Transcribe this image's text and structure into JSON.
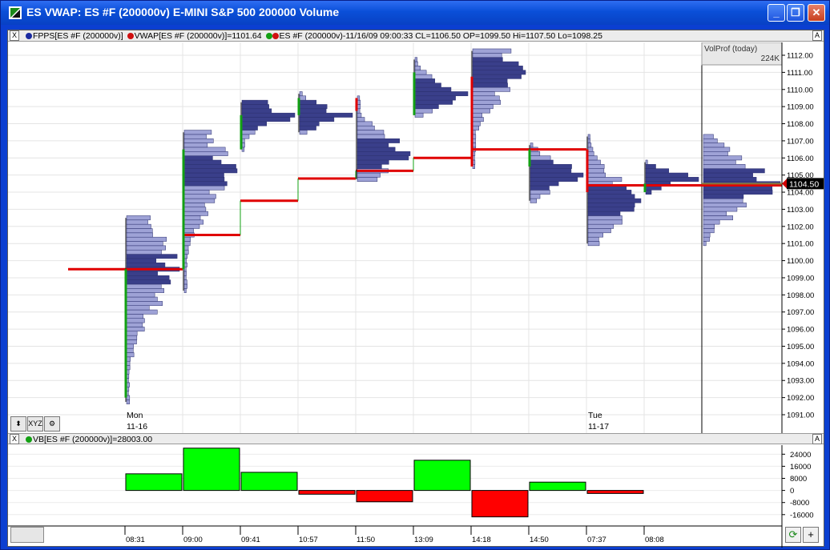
{
  "window": {
    "title": "ES VWAP: ES #F (200000v) E-MINI S&P 500 200000 Volume",
    "buttons": {
      "minimize": "_",
      "maximize": "❐",
      "close": "✕"
    }
  },
  "main_panel": {
    "close_label": "X",
    "auto_label": "A",
    "legend": [
      {
        "color": "#1a2aa0",
        "text": "FPPS[ES #F (200000v)]"
      },
      {
        "color": "#d01010",
        "text": "VWAP[ES #F (200000v)]=1101.64"
      },
      {
        "color": "#13a013",
        "color2": "#d01010",
        "text": "ES #F (200000v)-11/16/09 09:00:33 CL=1106.50 OP=1099.50 Hi=1107.50 Lo=1098.25"
      }
    ],
    "volprof": {
      "label": "VolProf (today)",
      "volume": "224K"
    },
    "price_label": "1104.50",
    "day_labels": [
      {
        "line1": "Mon",
        "line2": "11-16"
      },
      {
        "line1": "Tue",
        "line2": "11-17"
      }
    ],
    "tools": [
      "⬍",
      "XYZ",
      "⚙"
    ]
  },
  "vb_panel": {
    "close_label": "X",
    "auto_label": "A",
    "legend": {
      "color": "#13a013",
      "text": "VB[ES #F (200000v)]=28003.00"
    }
  },
  "footer_buttons": [
    "⟳",
    "+"
  ],
  "chart_data": [
    {
      "type": "bar",
      "subtype": "volume-profile-candles",
      "title": "",
      "y_axis": {
        "range": [
          1091,
          1112
        ],
        "ticks": [
          "1091.00",
          "1092.00",
          "1093.00",
          "1094.00",
          "1095.00",
          "1096.00",
          "1097.00",
          "1098.00",
          "1099.00",
          "1100.00",
          "1101.00",
          "1102.00",
          "1103.00",
          "1104.00",
          "1105.00",
          "1106.00",
          "1107.00",
          "1108.00",
          "1109.00",
          "1110.00",
          "1111.00",
          "1112.00"
        ]
      },
      "grid": true,
      "bars": [
        {
          "time": "08:31",
          "open": 1092.0,
          "close": 1099.5,
          "low": 1091.75,
          "high": 1102.5,
          "vwap": 1099.5,
          "poc": 1099.5,
          "color": "green"
        },
        {
          "time": "09:00",
          "open": 1099.5,
          "close": 1106.5,
          "low": 1098.25,
          "high": 1107.5,
          "vwap": 1101.5,
          "poc": 1105.25,
          "color": "green"
        },
        {
          "time": "09:41",
          "open": 1106.5,
          "close": 1108.5,
          "low": 1106.5,
          "high": 1109.25,
          "vwap": 1103.5,
          "poc": 1108.5,
          "color": "green"
        },
        {
          "time": "10:57",
          "open": 1108.5,
          "close": 1109.5,
          "low": 1107.5,
          "high": 1109.75,
          "vwap": 1104.8,
          "poc": 1108.5,
          "color": "green"
        },
        {
          "time": "11:50",
          "open": 1109.5,
          "close": 1108.75,
          "low": 1104.75,
          "high": 1109.5,
          "vwap": 1105.25,
          "poc": 1106.25,
          "color": "red"
        },
        {
          "time": "13:09",
          "open": 1108.5,
          "close": 1111.0,
          "low": 1108.5,
          "high": 1111.75,
          "vwap": 1106.0,
          "poc": 1109.75,
          "color": "green"
        },
        {
          "time": "14:18",
          "open": 1110.75,
          "close": 1105.5,
          "low": 1105.5,
          "high": 1112.25,
          "vwap": 1106.5,
          "poc": 1111.0,
          "color": "red"
        },
        {
          "time": "14:50",
          "open": 1105.5,
          "close": 1106.5,
          "low": 1103.5,
          "high": 1106.75,
          "vwap": 1106.5,
          "poc": 1105.0,
          "color": "green"
        },
        {
          "time": "07:37",
          "open": 1106.5,
          "close": 1104.0,
          "low": 1101.0,
          "high": 1107.25,
          "vwap": 1104.4,
          "poc": 1103.5,
          "color": "red"
        },
        {
          "time": "08:08",
          "open": 1104.0,
          "close": 1104.5,
          "low": 1104.0,
          "high": 1105.75,
          "vwap": 1104.4,
          "poc": 1104.75,
          "color": "green"
        }
      ],
      "volume_profile_today": {
        "low": 1101.0,
        "high": 1107.25,
        "poc": 1104.5
      },
      "last_price": 1104.5
    },
    {
      "type": "bar",
      "title": "",
      "series": [
        {
          "name": "VB[ES #F (200000v)]",
          "values": [
            11000,
            28003,
            12000,
            -2500,
            -7500,
            20000,
            -17500,
            5500,
            -2000,
            0
          ]
        }
      ],
      "categories": [
        "08:31",
        "09:00",
        "09:41",
        "10:57",
        "11:50",
        "13:09",
        "14:18",
        "14:50",
        "07:37",
        "08:08"
      ],
      "y_axis": {
        "range": [
          -20000,
          30000
        ],
        "ticks": [
          "24000",
          "16000",
          "8000",
          "0",
          "-8000",
          "-16000"
        ]
      },
      "x_tick_labels": [
        "08:31",
        "09:00",
        "09:41",
        "10:57",
        "11:50",
        "13:09",
        "14:18",
        "14:50",
        "07:37",
        "08:08"
      ],
      "colors": {
        "positive": "#00ff00",
        "negative": "#ff0000"
      }
    }
  ]
}
